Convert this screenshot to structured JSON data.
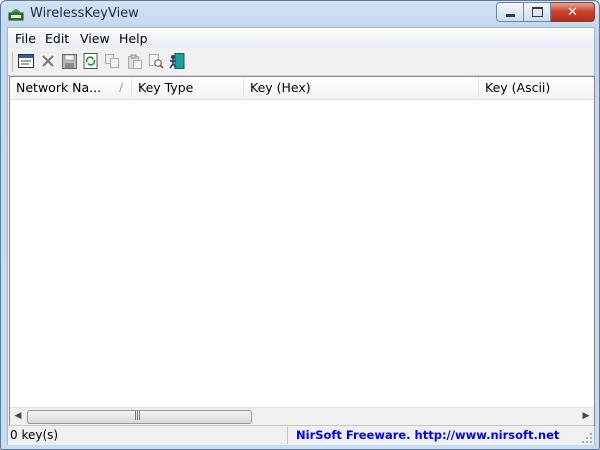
{
  "window": {
    "title": "WirelessKeyView"
  },
  "menu": {
    "items": [
      "File",
      "Edit",
      "View",
      "Help"
    ]
  },
  "toolbar": {
    "buttons": [
      "properties-icon",
      "delete-icon",
      "save-icon",
      "refresh-icon",
      "copy-icon",
      "paste-icon",
      "find-icon",
      "exit-icon"
    ]
  },
  "listview": {
    "columns": [
      {
        "label": "Network Na..."
      },
      {
        "label": "Key Type"
      },
      {
        "label": "Key (Hex)"
      },
      {
        "label": "Key (Ascii)"
      }
    ],
    "rows": []
  },
  "status": {
    "left": "0 key(s)",
    "right": "NirSoft Freeware.  http://www.nirsoft.net"
  },
  "colors": {
    "link": "#0000ff",
    "close_button": "#c7412d"
  }
}
